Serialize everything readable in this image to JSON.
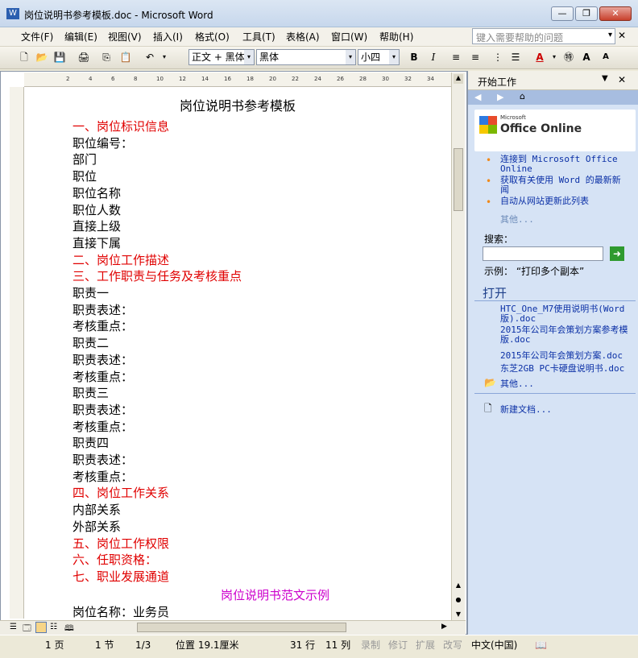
{
  "window": {
    "title": "岗位说明书参考模板.doc - Microsoft Word",
    "minimize": "—",
    "restore": "❐",
    "close": "✕"
  },
  "menu": {
    "items": [
      "文件(F)",
      "编辑(E)",
      "视图(V)",
      "插入(I)",
      "格式(O)",
      "工具(T)",
      "表格(A)",
      "窗口(W)",
      "帮助(H)"
    ],
    "ask_placeholder": "键入需要帮助的问题",
    "ask_arrow": "▾",
    "close_glyph": "✕"
  },
  "toolbar": {
    "style": "正文 + 黑体",
    "font": "黑体",
    "size": "小四",
    "bold": "B",
    "italic": "I",
    "font_color": "A",
    "grow": "A",
    "shrink": "A",
    "dd": "▾"
  },
  "ruler": {
    "h_ticks": [
      "2",
      "4",
      "6",
      "8",
      "10",
      "12",
      "14",
      "16",
      "18",
      "20",
      "22",
      "24",
      "26",
      "28",
      "30",
      "32",
      "34"
    ]
  },
  "document": {
    "title": "岗位说明书参考模板",
    "lines": [
      {
        "t": "一、岗位标识信息",
        "c": "red"
      },
      {
        "t": "职位编号：",
        "c": "black"
      },
      {
        "t": "部门",
        "c": "black"
      },
      {
        "t": "职位",
        "c": "black"
      },
      {
        "t": "职位名称",
        "c": "black"
      },
      {
        "t": "职位人数",
        "c": "black"
      },
      {
        "t": "直接上级",
        "c": "black"
      },
      {
        "t": "直接下属",
        "c": "black"
      },
      {
        "t": "二、岗位工作描述",
        "c": "red"
      },
      {
        "t": "三、工作职责与任务及考核重点",
        "c": "red"
      },
      {
        "t": "职责一",
        "c": "black"
      },
      {
        "t": "职责表述：",
        "c": "black"
      },
      {
        "t": "考核重点：",
        "c": "black"
      },
      {
        "t": "职责二",
        "c": "black"
      },
      {
        "t": "职责表述：",
        "c": "black"
      },
      {
        "t": "考核重点：",
        "c": "black"
      },
      {
        "t": "职责三",
        "c": "black"
      },
      {
        "t": "职责表述：",
        "c": "black"
      },
      {
        "t": "考核重点：",
        "c": "black"
      },
      {
        "t": "职责四",
        "c": "black"
      },
      {
        "t": "职责表述：",
        "c": "black"
      },
      {
        "t": "考核重点：",
        "c": "black"
      },
      {
        "t": "四、岗位工作关系",
        "c": "red"
      },
      {
        "t": "内部关系",
        "c": "black"
      },
      {
        "t": "外部关系",
        "c": "black"
      },
      {
        "t": "五、岗位工作权限",
        "c": "red"
      },
      {
        "t": "六、任职资格：",
        "c": "red"
      },
      {
        "t": "七、职业发展通道",
        "c": "red"
      }
    ],
    "example_heading": "岗位说明书范文示例",
    "last_line": "岗位名称：业务员"
  },
  "statusbar": {
    "page": "1 页",
    "section": "1 节",
    "pages": "1/3",
    "position": "位置 19.1厘米",
    "line": "31 行",
    "col": "11 列",
    "rec": "录制",
    "trk": "修订",
    "ext": "扩展",
    "ovr": "改写",
    "lang": "中文(中国)"
  },
  "taskpane": {
    "title": "开始工作",
    "logo_small": "Microsoft",
    "logo": "Office Online",
    "links": [
      "连接到 Microsoft Office Online",
      "获取有关使用 Word 的最新新闻",
      "自动从网站更新此列表"
    ],
    "more": "其他...",
    "search_label": "搜索：",
    "search_example": "示例：  “打印多个副本”",
    "open_title": "打开",
    "recent": [
      "HTC_One_M7使用说明书(Word版).doc",
      "2015年公司年会策划方案参考模版.doc",
      "2015年公司年会策划方案.doc",
      "东芝2GB PC卡硬盘说明书.doc"
    ],
    "open_more": "其他...",
    "new_doc": "新建文档..."
  }
}
